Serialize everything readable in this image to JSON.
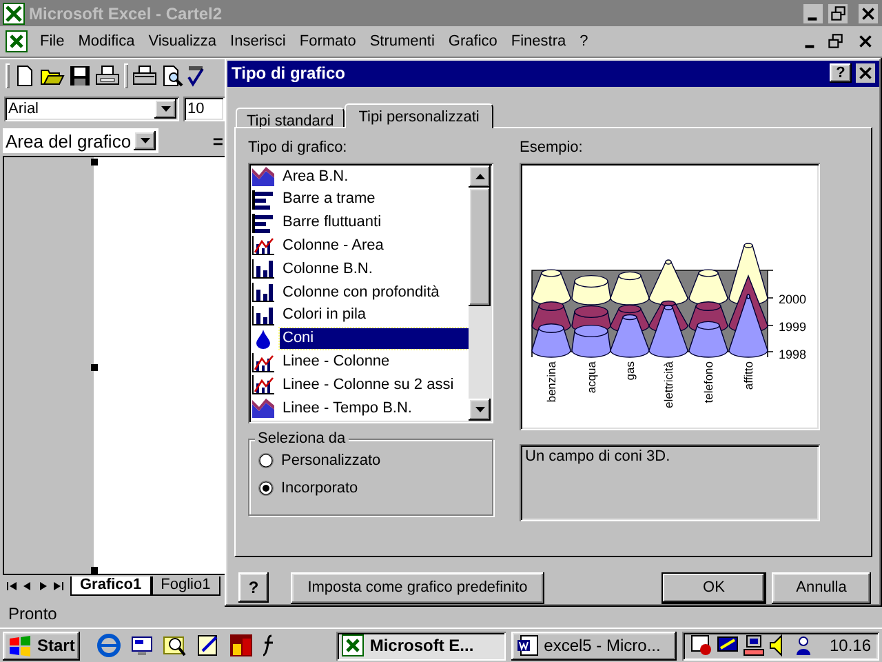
{
  "app_window": {
    "title": "Microsoft Excel - Cartel2"
  },
  "menu": [
    "File",
    "Modifica",
    "Visualizza",
    "Inserisci",
    "Formato",
    "Strumenti",
    "Grafico",
    "Finestra",
    "?"
  ],
  "format_bar": {
    "font": "Arial",
    "size": "10"
  },
  "chart_object_selector": {
    "value": "Area del grafico",
    "formula_sign": "="
  },
  "sheet_tabs": [
    {
      "label": "Grafico1",
      "selected": true
    },
    {
      "label": "Foglio1",
      "selected": false
    }
  ],
  "status_bar": "Pronto",
  "dialog": {
    "title": "Tipo di grafico",
    "title_help": "?",
    "help": "?",
    "tabs": [
      {
        "label": "Tipi standard",
        "selected": false
      },
      {
        "label": "Tipi personalizzati",
        "selected": true
      }
    ],
    "list_label": "Tipo di grafico:",
    "chart_types": [
      {
        "label": "Area B.N.",
        "kind": "area",
        "selected": false
      },
      {
        "label": "Barre a trame",
        "kind": "bar",
        "selected": false
      },
      {
        "label": "Barre fluttuanti",
        "kind": "bar",
        "selected": false
      },
      {
        "label": "Colonne - Area",
        "kind": "columnline",
        "selected": false
      },
      {
        "label": "Colonne B.N.",
        "kind": "column",
        "selected": false
      },
      {
        "label": "Colonne con profondità",
        "kind": "column",
        "selected": false
      },
      {
        "label": "Colori in pila",
        "kind": "column",
        "selected": false
      },
      {
        "label": "Coni",
        "kind": "cone",
        "selected": true
      },
      {
        "label": "Linee - Colonne",
        "kind": "columnline",
        "selected": false
      },
      {
        "label": "Linee - Colonne su 2 assi",
        "kind": "columnline",
        "selected": false
      },
      {
        "label": "Linee - Tempo B.N.",
        "kind": "area",
        "selected": false
      }
    ],
    "select_from": {
      "label": "Seleziona da",
      "options": [
        {
          "label": "Personalizzato",
          "selected": false
        },
        {
          "label": "Incorporato",
          "selected": true
        }
      ]
    },
    "example_label": "Esempio:",
    "example_chart": {
      "categories": [
        "benzina",
        "acqua",
        "gas",
        "elettricità",
        "telefono",
        "affitto"
      ],
      "series_labels": [
        "2000",
        "1999",
        "1998"
      ]
    },
    "description": "Un campo di coni 3D.",
    "buttons": [
      {
        "label": "Imposta come grafico predefinito",
        "kind": "wide"
      },
      {
        "label": "OK",
        "kind": "default"
      },
      {
        "label": "Annulla",
        "kind": "normal"
      }
    ]
  },
  "taskbar": {
    "start": "Start",
    "tasks": [
      {
        "label": "Microsoft E...",
        "kind": "excel",
        "selected": true
      },
      {
        "label": "excel5 - Micro...",
        "kind": "word",
        "selected": false
      }
    ],
    "clock": "10.16"
  }
}
